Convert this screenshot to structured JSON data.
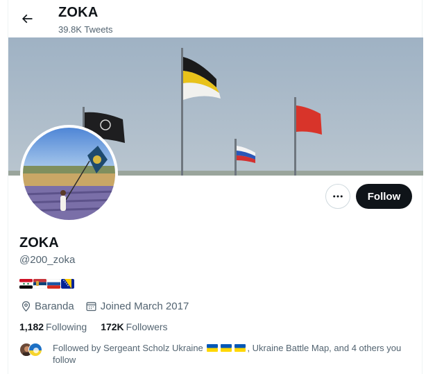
{
  "header": {
    "name": "ZOKA",
    "tweet_count": "39.8K Tweets"
  },
  "actions": {
    "follow_label": "Follow"
  },
  "profile": {
    "name": "ZOKA",
    "handle": "@200_zoka",
    "flags": [
      "flag-syria",
      "flag-serbia",
      "flag-russia",
      "flag-bosnia"
    ],
    "location": "Baranda",
    "joined": "Joined March 2017"
  },
  "stats": {
    "following_count": "1,182",
    "following_label": "Following",
    "followers_count": "172K",
    "followers_label": "Followers"
  },
  "followed_by": {
    "prefix": "Followed by Sergeant Scholz Ukraine",
    "suffix": ", Ukraine Battle Map, and 4 others you follow",
    "emoji": [
      "flag-ukraine",
      "flag-ukraine",
      "flag-ukraine"
    ]
  },
  "icons": {
    "back": "arrow-left-icon",
    "more": "more-horizontal-icon",
    "location": "location-pin-icon",
    "calendar": "calendar-icon"
  },
  "colors": {
    "text_primary": "#0f1419",
    "text_secondary": "#536471",
    "button_dark": "#0f1419",
    "border": "#cfd9de"
  }
}
